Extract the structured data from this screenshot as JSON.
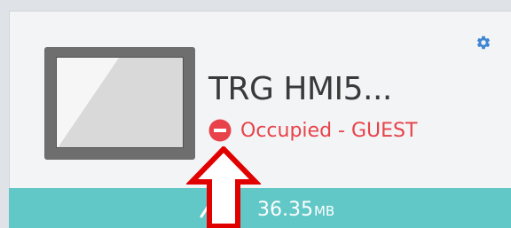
{
  "device": {
    "name": "TRG HMI5...",
    "status": "Occupied - GUEST",
    "size_value": "36.35",
    "size_unit": "MB"
  },
  "icons": {
    "settings": "gear-icon",
    "device": "monitor-icon",
    "status": "no-entry-icon",
    "transfer": "upload-icon",
    "pointer": "red-up-arrow"
  },
  "colors": {
    "status": "#e8424a",
    "bar": "#62c7c7",
    "gear": "#3f86d4",
    "arrow": "#e00000"
  }
}
